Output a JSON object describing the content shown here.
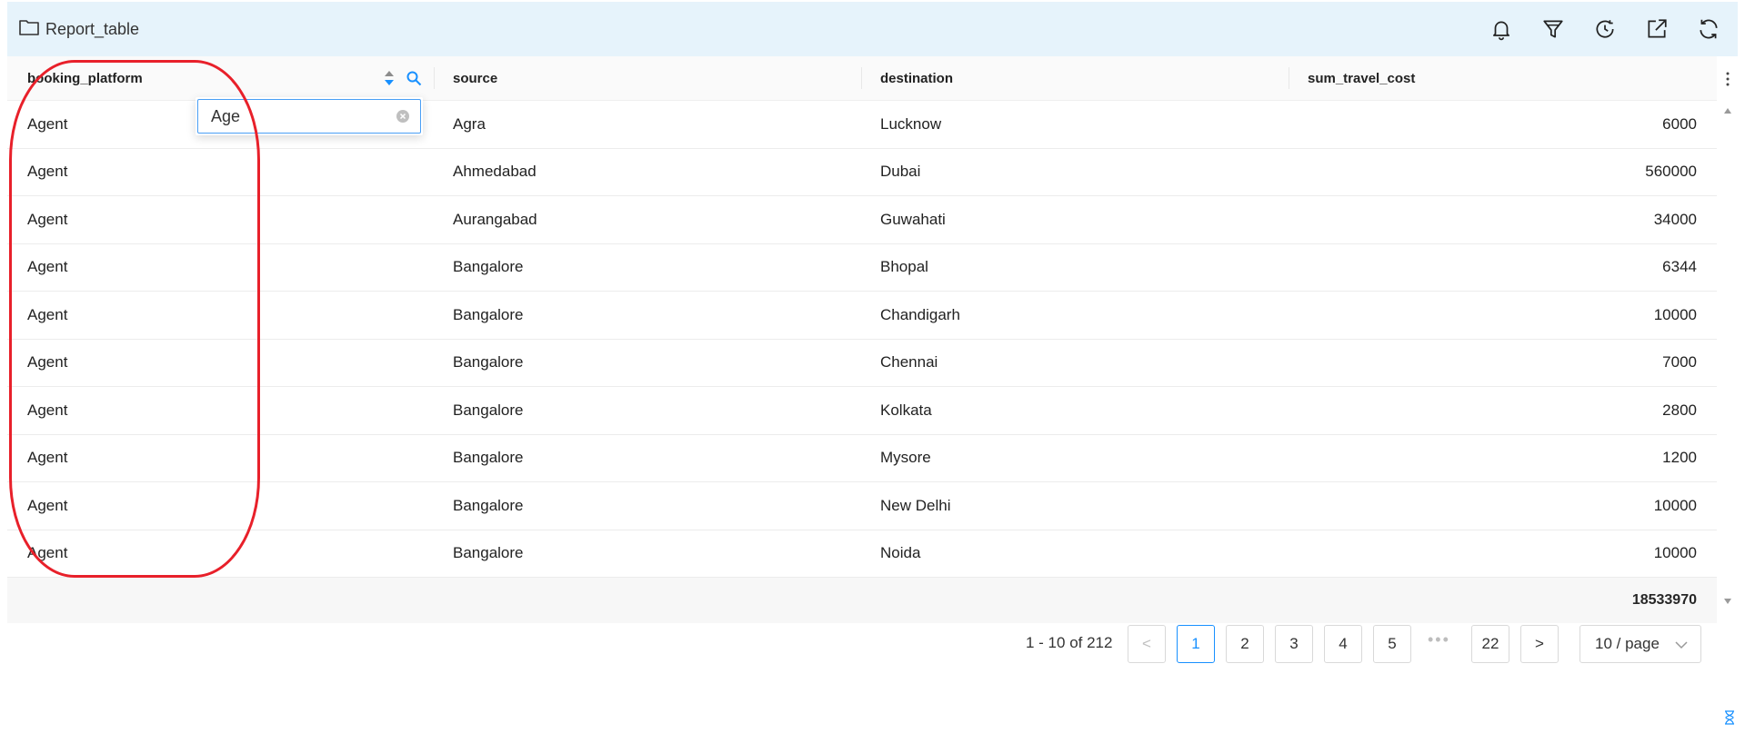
{
  "header": {
    "title": "Report_table",
    "icons": [
      "folder-icon",
      "bell-icon",
      "filter-icon",
      "history-icon",
      "export-icon",
      "refresh-icon"
    ]
  },
  "table": {
    "columns": [
      "booking_platform",
      "source",
      "destination",
      "sum_travel_cost"
    ],
    "rows": [
      [
        "Agent",
        "Agra",
        "Lucknow",
        "6000"
      ],
      [
        "Agent",
        "Ahmedabad",
        "Dubai",
        "560000"
      ],
      [
        "Agent",
        "Aurangabad",
        "Guwahati",
        "34000"
      ],
      [
        "Agent",
        "Bangalore",
        "Bhopal",
        "6344"
      ],
      [
        "Agent",
        "Bangalore",
        "Chandigarh",
        "10000"
      ],
      [
        "Agent",
        "Bangalore",
        "Chennai",
        "7000"
      ],
      [
        "Agent",
        "Bangalore",
        "Kolkata",
        "2800"
      ],
      [
        "Agent",
        "Bangalore",
        "Mysore",
        "1200"
      ],
      [
        "Agent",
        "Bangalore",
        "New Delhi",
        "10000"
      ],
      [
        "Agent",
        "Bangalore",
        "Noida",
        "10000"
      ]
    ],
    "total": "18533970"
  },
  "filter": {
    "value": "Age"
  },
  "pagination": {
    "summary": "1 - 10 of 212",
    "pages": [
      "1",
      "2",
      "3",
      "4",
      "5"
    ],
    "ellipsis": "•••",
    "last_page": "22",
    "current_page": "1",
    "page_size": "10 / page",
    "prev": "<",
    "next": ">"
  },
  "colors": {
    "header_bg": "#e6f3fb",
    "accent": "#1890ff",
    "highlight": "#e8202a"
  }
}
